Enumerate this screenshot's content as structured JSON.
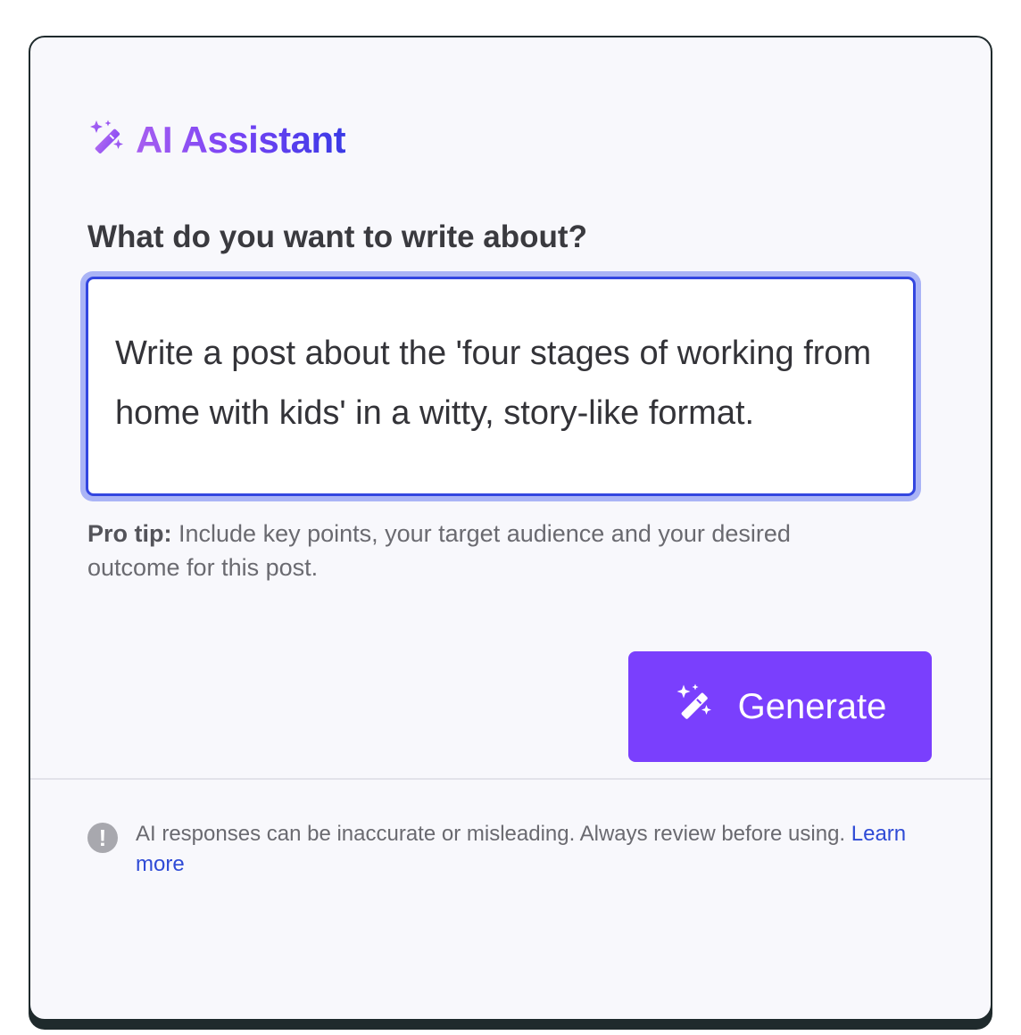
{
  "header": {
    "title": "AI Assistant",
    "icon": "magic-wand-sparkles-icon"
  },
  "form": {
    "question_label": "What do you want to write about?",
    "prompt_value": "Write a post about the 'four stages of working from home with kids' in a witty, story-like format.",
    "protip_label": "Pro tip:",
    "protip_text": " Include key points, your target audience and your desired outcome for this post."
  },
  "actions": {
    "generate_label": "Generate",
    "generate_icon": "magic-wand-sparkles-icon"
  },
  "footer": {
    "info_icon": "exclamation-circle-icon",
    "disclaimer_text": "AI responses can be inaccurate or misleading. Always review before using. ",
    "learn_more_label": "Learn more"
  },
  "colors": {
    "accent": "#7a3ffd",
    "focus_border": "#3346e0",
    "focus_ring": "#aab4f6",
    "link": "#2f4bd6",
    "card_bg": "#f8f8fc"
  }
}
